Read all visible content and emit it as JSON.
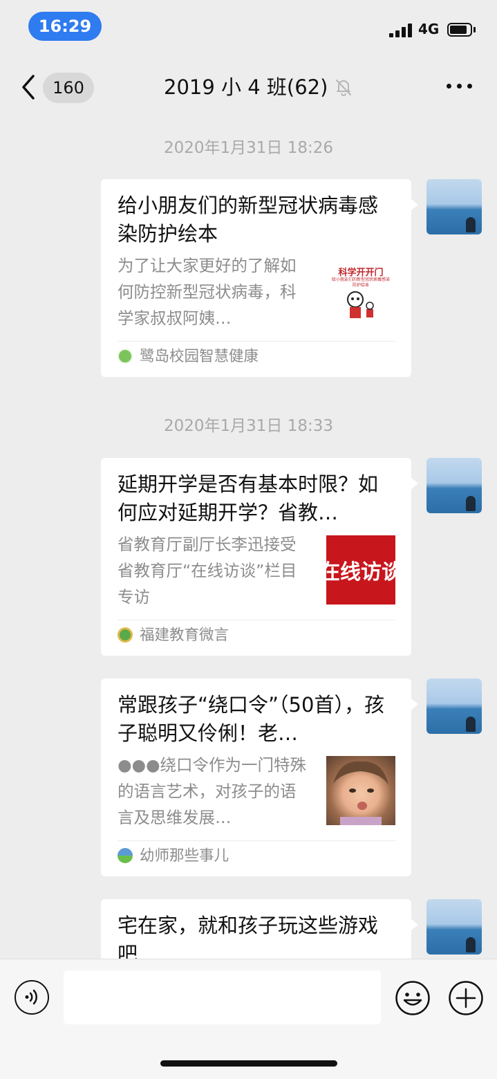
{
  "status_bar": {
    "time": "16:29",
    "network": "4G"
  },
  "nav": {
    "back_count": "160",
    "title": "2019 小 4 班(62)"
  },
  "messages": [
    {
      "timestamp": "2020年1月31日 18:26",
      "title": "给小朋友们的新型冠状病毒感染防护绘本",
      "desc": "为了让大家更好的了解如何防控新型冠状病毒，科学家叔叔阿姨…",
      "thumb_text": "科学开开门",
      "thumb_subtext": "给小朋友们的新型冠状病毒感染防护绘本",
      "source": "鹭岛校园智慧健康"
    },
    {
      "timestamp": "2020年1月31日 18:33",
      "title": "延期开学是否有基本时限？如何应对延期开学？省教…",
      "desc": "省教育厅副厅长李迅接受省教育厅“在线访谈”栏目专访",
      "thumb_text": "在线访谈",
      "source": "福建教育微言"
    },
    {
      "title": "常跟孩子“绕口令”（50首），孩子聪明又伶俐！老…",
      "desc": "●●●绕口令作为一门特殊的语言艺术，对孩子的语言及思维发展…",
      "source": "幼师那些事儿"
    },
    {
      "title": "宅在家，就和孩子玩这些游戏吧"
    }
  ],
  "input": {
    "placeholder": ""
  },
  "colors": {
    "background": "#ededed",
    "bubble": "#ffffff",
    "time_pill": "#2f7bf0",
    "meta_text": "#a9a9a9"
  }
}
